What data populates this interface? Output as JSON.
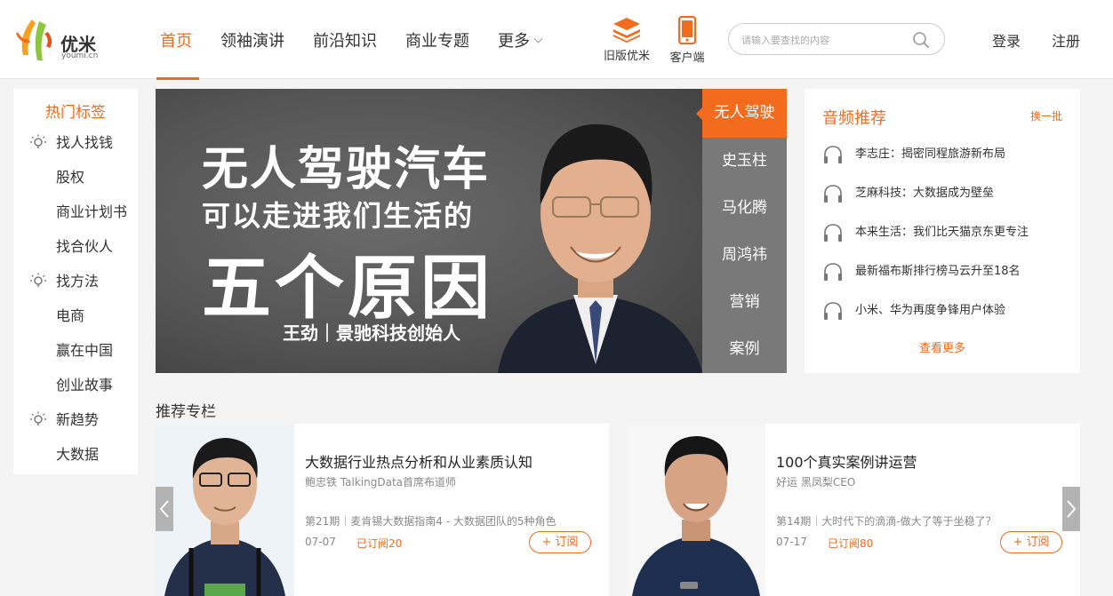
{
  "header": {
    "logo_text": "优米",
    "logo_domain": "youmi.cn",
    "nav": [
      {
        "label": "首页"
      },
      {
        "label": "领袖演讲"
      },
      {
        "label": "前沿知识"
      },
      {
        "label": "商业专题"
      },
      {
        "label": "更多"
      }
    ],
    "old_version_label": "旧版优米",
    "client_label": "客户端",
    "search_placeholder": "请输入要查找的内容",
    "login_label": "登录",
    "register_label": "注册",
    "accent_color": "#f36b1c"
  },
  "sidebar": {
    "title": "热门标签",
    "items": [
      {
        "label": "找人找钱",
        "kind": "category"
      },
      {
        "label": "股权",
        "kind": "tag"
      },
      {
        "label": "商业计划书",
        "kind": "tag"
      },
      {
        "label": "找合伙人",
        "kind": "tag"
      },
      {
        "label": "找方法",
        "kind": "category"
      },
      {
        "label": "电商",
        "kind": "tag"
      },
      {
        "label": "赢在中国",
        "kind": "tag"
      },
      {
        "label": "创业故事",
        "kind": "tag"
      },
      {
        "label": "新趋势",
        "kind": "category"
      },
      {
        "label": "大数据",
        "kind": "tag"
      }
    ]
  },
  "banner": {
    "headline_1": "无人驾驶汽车",
    "headline_2": "可以走进我们生活的",
    "headline_3": "五个原因",
    "caption": "王劲｜景驰科技创始人",
    "tabs": [
      {
        "label": "无人驾驶",
        "active": true
      },
      {
        "label": "史玉柱",
        "active": false
      },
      {
        "label": "马化腾",
        "active": false
      },
      {
        "label": "周鸿祎",
        "active": false
      },
      {
        "label": "营销",
        "active": false
      },
      {
        "label": "案例",
        "active": false
      }
    ]
  },
  "audio": {
    "title": "音频推荐",
    "refresh_label": "换一批",
    "items": [
      {
        "label": "李志庄：揭密同程旅游新布局"
      },
      {
        "label": "芝麻科技：大数据成为壁垒"
      },
      {
        "label": "本来生活：我们比天猫京东更专注"
      },
      {
        "label": "最新福布斯排行榜马云升至18名"
      },
      {
        "label": "小米、华为再度争锋用户体验"
      }
    ],
    "more_label": "查看更多"
  },
  "columns": {
    "section_title": "推荐专栏",
    "cards": [
      {
        "title": "大数据行业热点分析和从业素质认知",
        "author": "鲍忠铁 TalkingData首席布道师",
        "episode": "第21期｜麦肯锡大数据指南4 - 大数据团队的5种角色",
        "date": "07-07",
        "subs": "已订阅20",
        "subscribe_label": "+ 订阅"
      },
      {
        "title": "100个真实案例讲运营",
        "author": "好运 黑凤梨CEO",
        "episode": "第14期｜大时代下的滴滴-做大了等于坐稳了？",
        "date": "07-17",
        "subs": "已订阅80",
        "subscribe_label": "+ 订阅"
      }
    ]
  }
}
